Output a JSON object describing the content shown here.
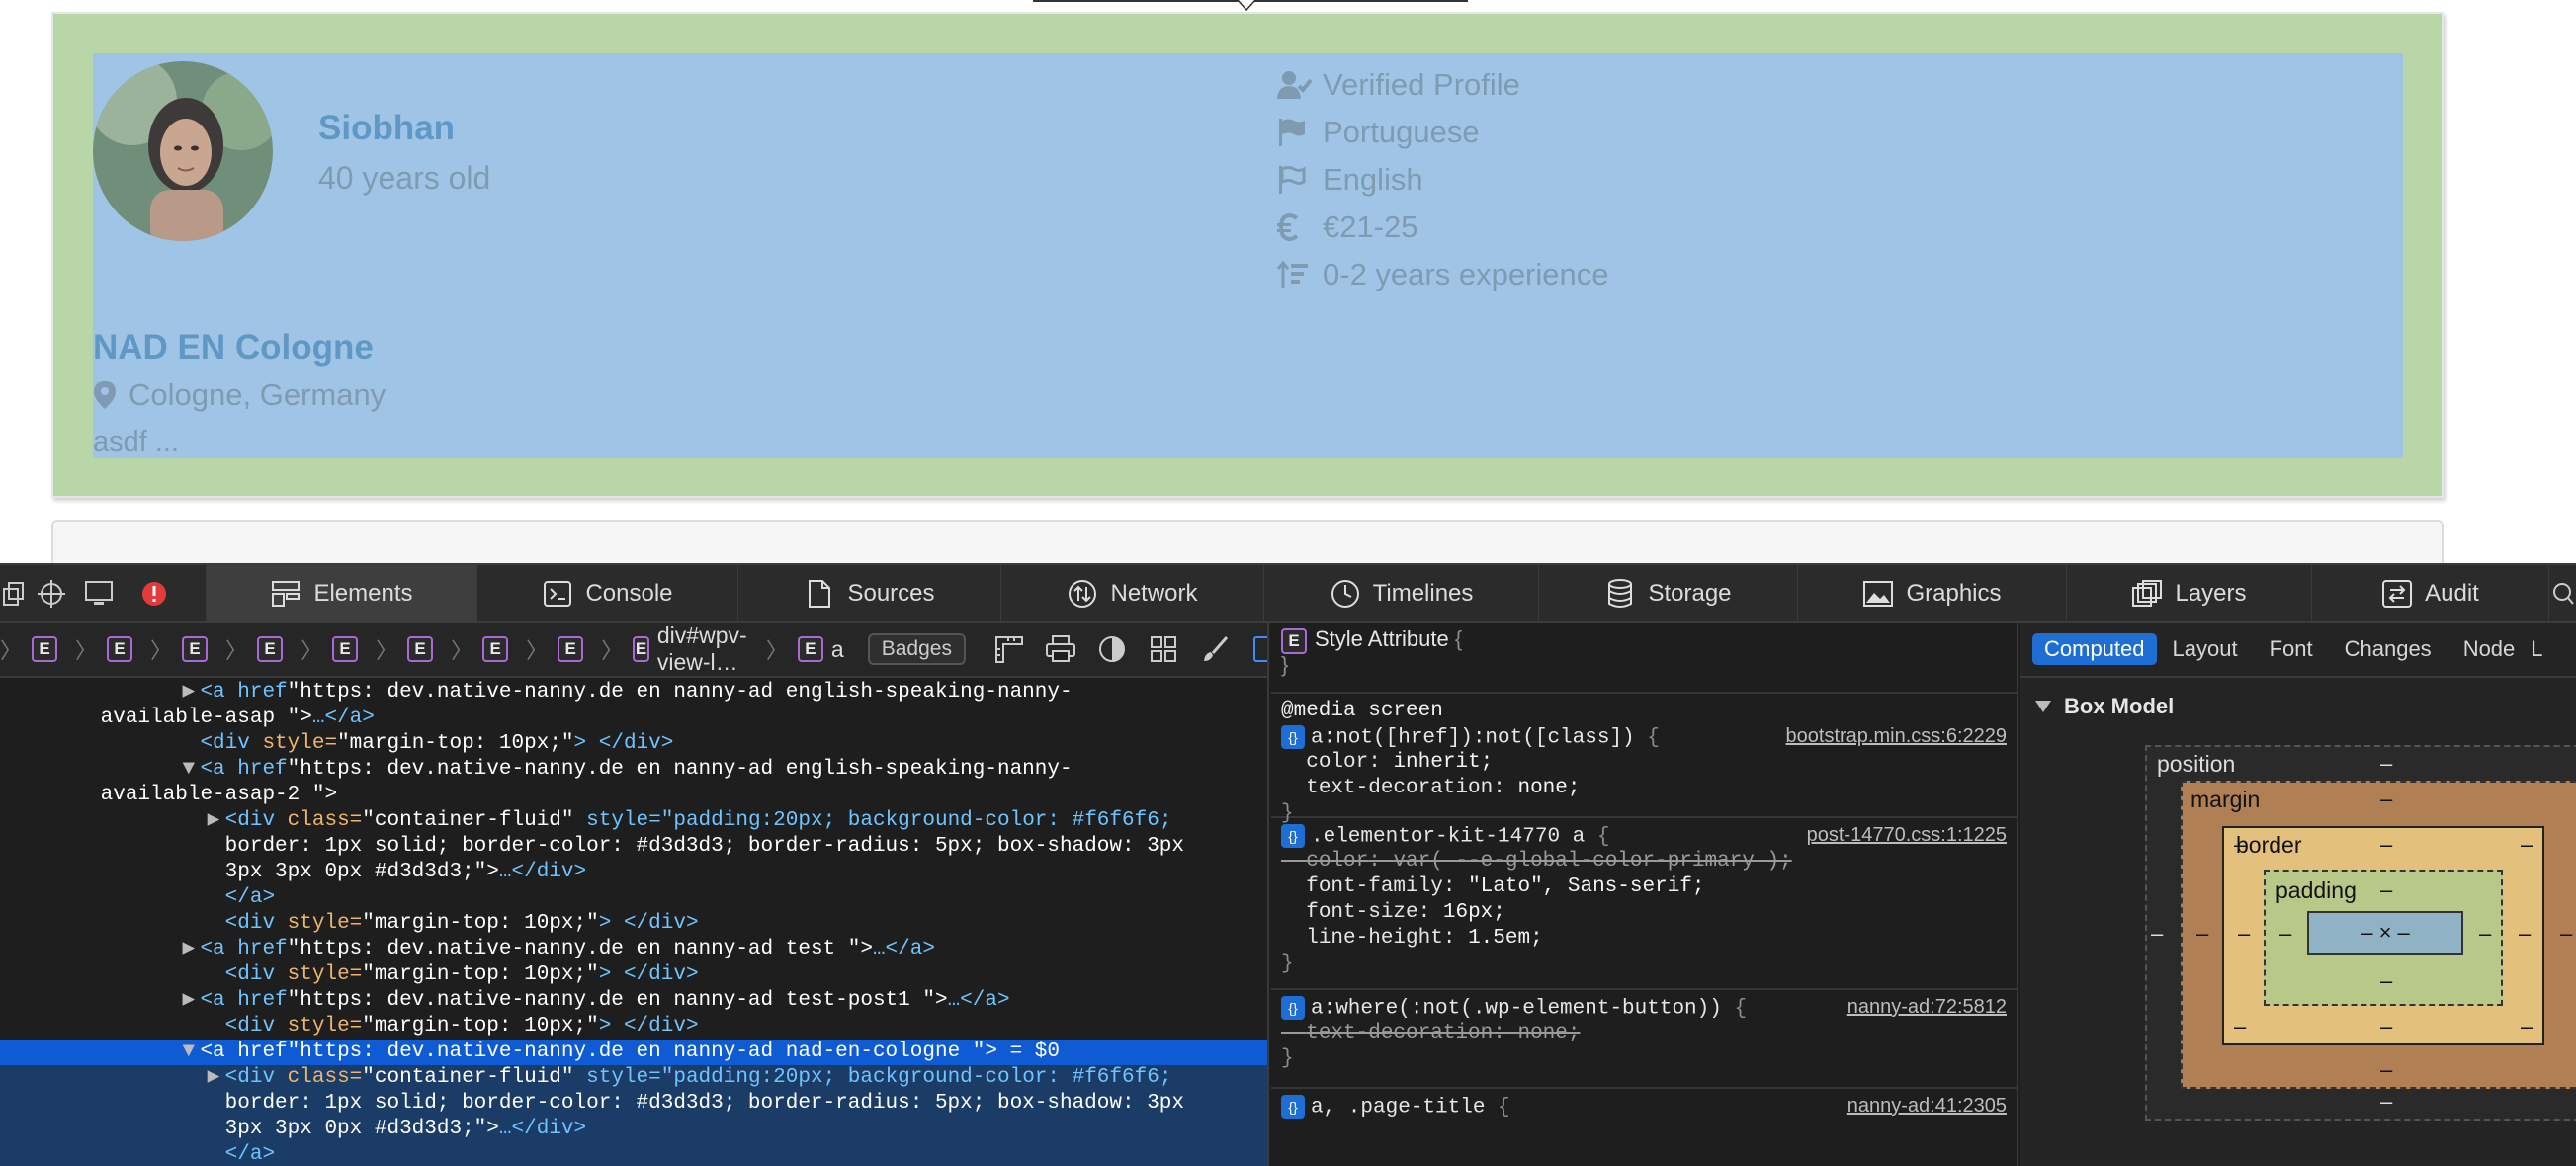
{
  "profile": {
    "name": "Siobhan",
    "age": "40 years old",
    "facts": [
      {
        "icon": "verified-user-icon",
        "label": "Verified Profile"
      },
      {
        "icon": "flag-solid-icon",
        "label": "Portuguese"
      },
      {
        "icon": "flag-outline-icon",
        "label": "English"
      },
      {
        "icon": "euro-icon",
        "label": "€21-25"
      },
      {
        "icon": "sort-amount-icon",
        "label": "0-2 years experience"
      }
    ],
    "ad_title": "NAD EN Cologne",
    "location": "Cologne, Germany",
    "description": "asdf ..."
  },
  "inspector": {
    "tabs": [
      "Elements",
      "Console",
      "Sources",
      "Network",
      "Timelines",
      "Storage",
      "Graphics",
      "Layers",
      "Audit"
    ],
    "active_tab": "Elements",
    "breadcrumb": {
      "badge": "E",
      "current": "div#wpv-view-l…",
      "last": "a",
      "badges_label": "Badges"
    },
    "dom_lines": [
      {
        "indent": 7,
        "tri": "▶",
        "tag": "<a href",
        "attr": "",
        "val": "\"https: dev.native-nanny.de en nanny-ad english-speaking-nanny-",
        "tail": ""
      },
      {
        "indent": 3,
        "tri": "",
        "tag": "",
        "attr": "",
        "val": "available-asap \">",
        "tail": "…</a>"
      },
      {
        "indent": 7,
        "tri": "",
        "tag": "<div ",
        "attr": "style=",
        "val": "\"margin-top: 10px;\"",
        "tail": "> </div>"
      },
      {
        "indent": 7,
        "tri": "▼",
        "tag": "<a href",
        "attr": "",
        "val": "\"https: dev.native-nanny.de en nanny-ad english-speaking-nanny-",
        "tail": ""
      },
      {
        "indent": 3,
        "tri": "",
        "tag": "",
        "attr": "",
        "val": "available-asap-2 \">",
        "tail": ""
      },
      {
        "indent": 8,
        "tri": "▶",
        "tag": "<div ",
        "attr": "class=",
        "val": "\"container-fluid\" ",
        "tail": "style=\"padding:20px; background-color: #f6f6f6;"
      },
      {
        "indent": 8,
        "tri": "",
        "tag": "",
        "attr": "",
        "val": "border: 1px solid; border-color: #d3d3d3; border-radius: 5px; box-shadow: 3px",
        "tail": ""
      },
      {
        "indent": 8,
        "tri": "",
        "tag": "",
        "attr": "",
        "val": "3px 3px 0px #d3d3d3;\">",
        "tail": "…</div>"
      },
      {
        "indent": 8,
        "tri": "",
        "tag": "</a>",
        "attr": "",
        "val": "",
        "tail": ""
      },
      {
        "indent": 8,
        "tri": "",
        "tag": "<div ",
        "attr": "style=",
        "val": "\"margin-top: 10px;\"",
        "tail": "> </div>"
      },
      {
        "indent": 7,
        "tri": "▶",
        "tag": "<a href",
        "attr": "",
        "val": "\"https: dev.native-nanny.de en nanny-ad test \">",
        "tail": "…</a>"
      },
      {
        "indent": 8,
        "tri": "",
        "tag": "<div ",
        "attr": "style=",
        "val": "\"margin-top: 10px;\"",
        "tail": "> </div>"
      },
      {
        "indent": 7,
        "tri": "▶",
        "tag": "<a href",
        "attr": "",
        "val": "\"https: dev.native-nanny.de en nanny-ad test-post1 \">",
        "tail": "…</a>"
      },
      {
        "indent": 8,
        "tri": "",
        "tag": "<div ",
        "attr": "style=",
        "val": "\"margin-top: 10px;\"",
        "tail": "> </div>"
      },
      {
        "indent": 7,
        "tri": "▼",
        "tag": "<a href",
        "attr": "",
        "val": "\"https: dev.native-nanny.de en nanny-ad nad-en-cologne \">",
        "tail": " = $0",
        "selected": true
      },
      {
        "indent": 8,
        "tri": "▶",
        "tag": "<div ",
        "attr": "class=",
        "val": "\"container-fluid\" ",
        "tail": "style=\"padding:20px; background-color: #f6f6f6;",
        "sub": true
      },
      {
        "indent": 8,
        "tri": "",
        "tag": "",
        "attr": "",
        "val": "border: 1px solid; border-color: #d3d3d3; border-radius: 5px; box-shadow: 3px",
        "tail": "",
        "sub": true
      },
      {
        "indent": 8,
        "tri": "",
        "tag": "",
        "attr": "",
        "val": "3px 3px 0px #d3d3d3;\">",
        "tail": "…</div>",
        "sub": true
      },
      {
        "indent": 8,
        "tri": "",
        "tag": "</a>",
        "attr": "",
        "val": "",
        "tail": "",
        "sub": true
      }
    ],
    "styles": {
      "style_attribute": "Style Attribute",
      "media": "@media screen",
      "rules": [
        {
          "selector": "a:not([href]):not([class])",
          "source": "bootstrap.min.css:6:2229",
          "props": [
            {
              "name": "color",
              "value": "inherit;"
            },
            {
              "name": "text-decoration",
              "value": "none;"
            }
          ]
        },
        {
          "selector": ".elementor-kit-14770 a",
          "source": "post-14770.css:1:1225",
          "props": [
            {
              "name": "color",
              "value": "var( --e-global-color-primary );",
              "struck": true
            },
            {
              "name": "font-family",
              "value": "\"Lato\", Sans-serif;"
            },
            {
              "name": "font-size",
              "value": "16px;"
            },
            {
              "name": "line-height",
              "value": "1.5em;"
            }
          ]
        },
        {
          "selector": "a:where(:not(.wp-element-button))",
          "source": "nanny-ad:72:5812",
          "props": [
            {
              "name": "text-decoration",
              "value": "none;",
              "struck": true
            }
          ]
        },
        {
          "selector": "a, .page-title",
          "source": "nanny-ad:41:2305",
          "props": []
        }
      ]
    },
    "computed": {
      "subtabs": [
        "Computed",
        "Layout",
        "Font",
        "Changes",
        "Node",
        "L"
      ],
      "section": "Box Model",
      "labels": {
        "position": "position",
        "margin": "margin",
        "border": "border",
        "padding": "padding"
      },
      "dash": "–",
      "content": "– × –",
      "colors": {
        "margin": "#b07f53",
        "border": "#e3c17d",
        "padding": "#b7c888",
        "content": "#8fb3c4"
      }
    }
  }
}
